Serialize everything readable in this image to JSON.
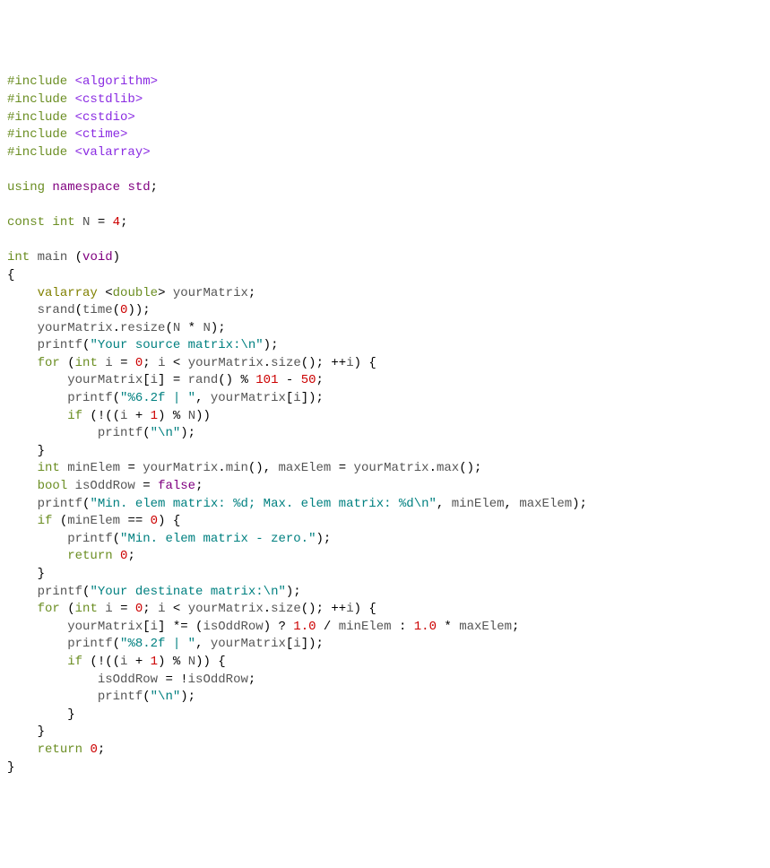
{
  "code": {
    "lines": [
      [
        [
          "kw-preproc",
          "#include"
        ],
        [
          "punct",
          " "
        ],
        [
          "header",
          "<algorithm>"
        ]
      ],
      [
        [
          "kw-preproc",
          "#include"
        ],
        [
          "punct",
          " "
        ],
        [
          "header",
          "<cstdlib>"
        ]
      ],
      [
        [
          "kw-preproc",
          "#include"
        ],
        [
          "punct",
          " "
        ],
        [
          "header",
          "<cstdio>"
        ]
      ],
      [
        [
          "kw-preproc",
          "#include"
        ],
        [
          "punct",
          " "
        ],
        [
          "header",
          "<ctime>"
        ]
      ],
      [
        [
          "kw-preproc",
          "#include"
        ],
        [
          "punct",
          " "
        ],
        [
          "header",
          "<valarray>"
        ]
      ],
      [],
      [
        [
          "kw-green",
          "using"
        ],
        [
          "punct",
          " "
        ],
        [
          "kw-purple",
          "namespace"
        ],
        [
          "punct",
          " "
        ],
        [
          "std",
          "std"
        ],
        [
          "punct",
          ";"
        ]
      ],
      [],
      [
        [
          "kw-green",
          "const"
        ],
        [
          "punct",
          " "
        ],
        [
          "kw-green",
          "int"
        ],
        [
          "punct",
          " "
        ],
        [
          "ident",
          "N"
        ],
        [
          "punct",
          " = "
        ],
        [
          "num",
          "4"
        ],
        [
          "punct",
          ";"
        ]
      ],
      [],
      [
        [
          "kw-green",
          "int"
        ],
        [
          "punct",
          " "
        ],
        [
          "ident",
          "main"
        ],
        [
          "punct",
          " ("
        ],
        [
          "kw-purple",
          "void"
        ],
        [
          "punct",
          ")"
        ]
      ],
      [
        [
          "brace",
          "{"
        ]
      ],
      [
        [
          "punct",
          "    "
        ],
        [
          "kw-type",
          "valarray"
        ],
        [
          "punct",
          " <"
        ],
        [
          "kw-green",
          "double"
        ],
        [
          "punct",
          "> "
        ],
        [
          "ident",
          "yourMatrix"
        ],
        [
          "punct",
          ";"
        ]
      ],
      [
        [
          "punct",
          "    "
        ],
        [
          "ident",
          "srand"
        ],
        [
          "punct",
          "("
        ],
        [
          "ident",
          "time"
        ],
        [
          "punct",
          "("
        ],
        [
          "num",
          "0"
        ],
        [
          "punct",
          "));"
        ]
      ],
      [
        [
          "punct",
          "    "
        ],
        [
          "ident",
          "yourMatrix"
        ],
        [
          "punct",
          "."
        ],
        [
          "ident",
          "resize"
        ],
        [
          "punct",
          "("
        ],
        [
          "ident",
          "N"
        ],
        [
          "punct",
          " * "
        ],
        [
          "ident",
          "N"
        ],
        [
          "punct",
          ");"
        ]
      ],
      [
        [
          "punct",
          "    "
        ],
        [
          "ident",
          "printf"
        ],
        [
          "punct",
          "("
        ],
        [
          "string",
          "\"Your source matrix:\\n\""
        ],
        [
          "punct",
          ");"
        ]
      ],
      [
        [
          "punct",
          "    "
        ],
        [
          "kw-green",
          "for"
        ],
        [
          "punct",
          " ("
        ],
        [
          "kw-green",
          "int"
        ],
        [
          "punct",
          " "
        ],
        [
          "ident",
          "i"
        ],
        [
          "punct",
          " = "
        ],
        [
          "num",
          "0"
        ],
        [
          "punct",
          "; "
        ],
        [
          "ident",
          "i"
        ],
        [
          "punct",
          " < "
        ],
        [
          "ident",
          "yourMatrix"
        ],
        [
          "punct",
          "."
        ],
        [
          "ident",
          "size"
        ],
        [
          "punct",
          "(); ++"
        ],
        [
          "ident",
          "i"
        ],
        [
          "punct",
          ") {"
        ]
      ],
      [
        [
          "punct",
          "        "
        ],
        [
          "ident",
          "yourMatrix"
        ],
        [
          "punct",
          "["
        ],
        [
          "ident",
          "i"
        ],
        [
          "punct",
          "] = "
        ],
        [
          "ident",
          "rand"
        ],
        [
          "punct",
          "() % "
        ],
        [
          "num",
          "101"
        ],
        [
          "punct",
          " - "
        ],
        [
          "num",
          "50"
        ],
        [
          "punct",
          ";"
        ]
      ],
      [
        [
          "punct",
          "        "
        ],
        [
          "ident",
          "printf"
        ],
        [
          "punct",
          "("
        ],
        [
          "string",
          "\"%6.2f | \""
        ],
        [
          "punct",
          ", "
        ],
        [
          "ident",
          "yourMatrix"
        ],
        [
          "punct",
          "["
        ],
        [
          "ident",
          "i"
        ],
        [
          "punct",
          "]);"
        ]
      ],
      [
        [
          "punct",
          "        "
        ],
        [
          "kw-green",
          "if"
        ],
        [
          "punct",
          " (!(("
        ],
        [
          "ident",
          "i"
        ],
        [
          "punct",
          " + "
        ],
        [
          "num",
          "1"
        ],
        [
          "punct",
          ") % "
        ],
        [
          "ident",
          "N"
        ],
        [
          "punct",
          "))"
        ]
      ],
      [
        [
          "punct",
          "            "
        ],
        [
          "ident",
          "printf"
        ],
        [
          "punct",
          "("
        ],
        [
          "string",
          "\"\\n\""
        ],
        [
          "punct",
          ");"
        ]
      ],
      [
        [
          "punct",
          "    }"
        ]
      ],
      [
        [
          "punct",
          "    "
        ],
        [
          "kw-green",
          "int"
        ],
        [
          "punct",
          " "
        ],
        [
          "ident",
          "minElem"
        ],
        [
          "punct",
          " = "
        ],
        [
          "ident",
          "yourMatrix"
        ],
        [
          "punct",
          "."
        ],
        [
          "ident",
          "min"
        ],
        [
          "punct",
          "(), "
        ],
        [
          "ident",
          "maxElem"
        ],
        [
          "punct",
          " = "
        ],
        [
          "ident",
          "yourMatrix"
        ],
        [
          "punct",
          "."
        ],
        [
          "ident",
          "max"
        ],
        [
          "punct",
          "();"
        ]
      ],
      [
        [
          "punct",
          "    "
        ],
        [
          "kw-green",
          "bool"
        ],
        [
          "punct",
          " "
        ],
        [
          "ident",
          "isOddRow"
        ],
        [
          "punct",
          " = "
        ],
        [
          "kw-purple",
          "false"
        ],
        [
          "punct",
          ";"
        ]
      ],
      [
        [
          "punct",
          "    "
        ],
        [
          "ident",
          "printf"
        ],
        [
          "punct",
          "("
        ],
        [
          "string",
          "\"Min. elem matrix: %d; Max. elem matrix: %d\\n\""
        ],
        [
          "punct",
          ", "
        ],
        [
          "ident",
          "minElem"
        ],
        [
          "punct",
          ", "
        ],
        [
          "ident",
          "maxElem"
        ],
        [
          "punct",
          ");"
        ]
      ],
      [
        [
          "punct",
          "    "
        ],
        [
          "kw-green",
          "if"
        ],
        [
          "punct",
          " ("
        ],
        [
          "ident",
          "minElem"
        ],
        [
          "punct",
          " == "
        ],
        [
          "num",
          "0"
        ],
        [
          "punct",
          ") {"
        ]
      ],
      [
        [
          "punct",
          "        "
        ],
        [
          "ident",
          "printf"
        ],
        [
          "punct",
          "("
        ],
        [
          "string",
          "\"Min. elem matrix - zero.\""
        ],
        [
          "punct",
          ");"
        ]
      ],
      [
        [
          "punct",
          "        "
        ],
        [
          "kw-green",
          "return"
        ],
        [
          "punct",
          " "
        ],
        [
          "num",
          "0"
        ],
        [
          "punct",
          ";"
        ]
      ],
      [
        [
          "punct",
          "    }"
        ]
      ],
      [
        [
          "punct",
          "    "
        ],
        [
          "ident",
          "printf"
        ],
        [
          "punct",
          "("
        ],
        [
          "string",
          "\"Your destinate matrix:\\n\""
        ],
        [
          "punct",
          ");"
        ]
      ],
      [
        [
          "punct",
          "    "
        ],
        [
          "kw-green",
          "for"
        ],
        [
          "punct",
          " ("
        ],
        [
          "kw-green",
          "int"
        ],
        [
          "punct",
          " "
        ],
        [
          "ident",
          "i"
        ],
        [
          "punct",
          " = "
        ],
        [
          "num",
          "0"
        ],
        [
          "punct",
          "; "
        ],
        [
          "ident",
          "i"
        ],
        [
          "punct",
          " < "
        ],
        [
          "ident",
          "yourMatrix"
        ],
        [
          "punct",
          "."
        ],
        [
          "ident",
          "size"
        ],
        [
          "punct",
          "(); ++"
        ],
        [
          "ident",
          "i"
        ],
        [
          "punct",
          ") {"
        ]
      ],
      [
        [
          "punct",
          "        "
        ],
        [
          "ident",
          "yourMatrix"
        ],
        [
          "punct",
          "["
        ],
        [
          "ident",
          "i"
        ],
        [
          "punct",
          "] *= ("
        ],
        [
          "ident",
          "isOddRow"
        ],
        [
          "punct",
          ") ? "
        ],
        [
          "num",
          "1.0"
        ],
        [
          "punct",
          " / "
        ],
        [
          "ident",
          "minElem"
        ],
        [
          "punct",
          " : "
        ],
        [
          "num",
          "1.0"
        ],
        [
          "punct",
          " * "
        ],
        [
          "ident",
          "maxElem"
        ],
        [
          "punct",
          ";"
        ]
      ],
      [
        [
          "punct",
          "        "
        ],
        [
          "ident",
          "printf"
        ],
        [
          "punct",
          "("
        ],
        [
          "string",
          "\"%8.2f | \""
        ],
        [
          "punct",
          ", "
        ],
        [
          "ident",
          "yourMatrix"
        ],
        [
          "punct",
          "["
        ],
        [
          "ident",
          "i"
        ],
        [
          "punct",
          "]);"
        ]
      ],
      [
        [
          "punct",
          "        "
        ],
        [
          "kw-green",
          "if"
        ],
        [
          "punct",
          " (!(("
        ],
        [
          "ident",
          "i"
        ],
        [
          "punct",
          " + "
        ],
        [
          "num",
          "1"
        ],
        [
          "punct",
          ") % "
        ],
        [
          "ident",
          "N"
        ],
        [
          "punct",
          ")) {"
        ]
      ],
      [
        [
          "punct",
          "            "
        ],
        [
          "ident",
          "isOddRow"
        ],
        [
          "punct",
          " = !"
        ],
        [
          "ident",
          "isOddRow"
        ],
        [
          "punct",
          ";"
        ]
      ],
      [
        [
          "punct",
          "            "
        ],
        [
          "ident",
          "printf"
        ],
        [
          "punct",
          "("
        ],
        [
          "string",
          "\"\\n\""
        ],
        [
          "punct",
          ");"
        ]
      ],
      [
        [
          "punct",
          "        }"
        ]
      ],
      [
        [
          "punct",
          "    }"
        ]
      ],
      [
        [
          "punct",
          "    "
        ],
        [
          "kw-green",
          "return"
        ],
        [
          "punct",
          " "
        ],
        [
          "num",
          "0"
        ],
        [
          "punct",
          ";"
        ]
      ],
      [
        [
          "brace",
          "}"
        ]
      ]
    ]
  }
}
